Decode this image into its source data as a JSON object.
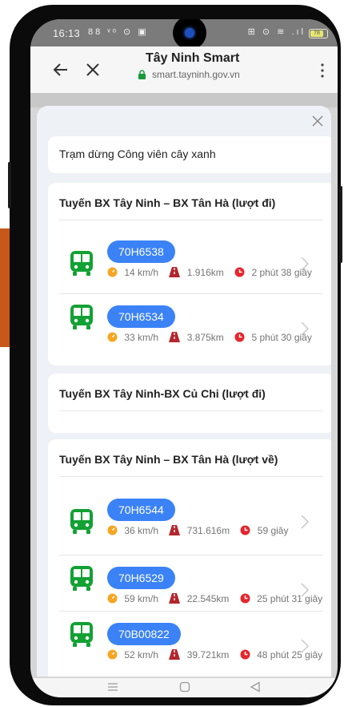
{
  "status": {
    "time": "16:13",
    "left_icons": "88 ᵛᵒ ⊙ ▣",
    "right_icons": "⊞ ⊙ ≋ .ıl",
    "battery": "78"
  },
  "browser": {
    "title": "Tây Ninh Smart",
    "url": "smart.tayninh.gov.vn"
  },
  "stop": {
    "name": "Trạm dừng Công viên cây xanh"
  },
  "routes": [
    {
      "name": "Tuyến BX Tây Ninh – BX Tân Hà (lượt đi)",
      "vehicles": [
        {
          "plate": "70H6538",
          "speed": "14 km/h",
          "distance": "1.916km",
          "eta": "2 phút 38 giây"
        },
        {
          "plate": "70H6534",
          "speed": "33 km/h",
          "distance": "3.875km",
          "eta": "5 phút 30 giây"
        }
      ]
    },
    {
      "name": "Tuyến BX Tây Ninh-BX Củ Chi (lượt đi)",
      "vehicles": []
    },
    {
      "name": "Tuyến BX Tây Ninh – BX Tân Hà (lượt về)",
      "vehicles": [
        {
          "plate": "70H6544",
          "speed": "36 km/h",
          "distance": "731.616m",
          "eta": "59 giây"
        },
        {
          "plate": "70H6529",
          "speed": "59 km/h",
          "distance": "22.545km",
          "eta": "25 phút 31 giây"
        },
        {
          "plate": "70B00822",
          "speed": "52 km/h",
          "distance": "39.721km",
          "eta": "48 phút 25 giây"
        }
      ]
    }
  ],
  "colors": {
    "accent": "#3b82f6",
    "bus": "#12a133",
    "speed": "#f5a623",
    "distance": "#b3262c",
    "eta": "#e5262c"
  },
  "icons": {
    "speed": "speedometer-icon",
    "distance": "road-icon",
    "eta": "clock-icon",
    "bus": "bus-icon"
  }
}
